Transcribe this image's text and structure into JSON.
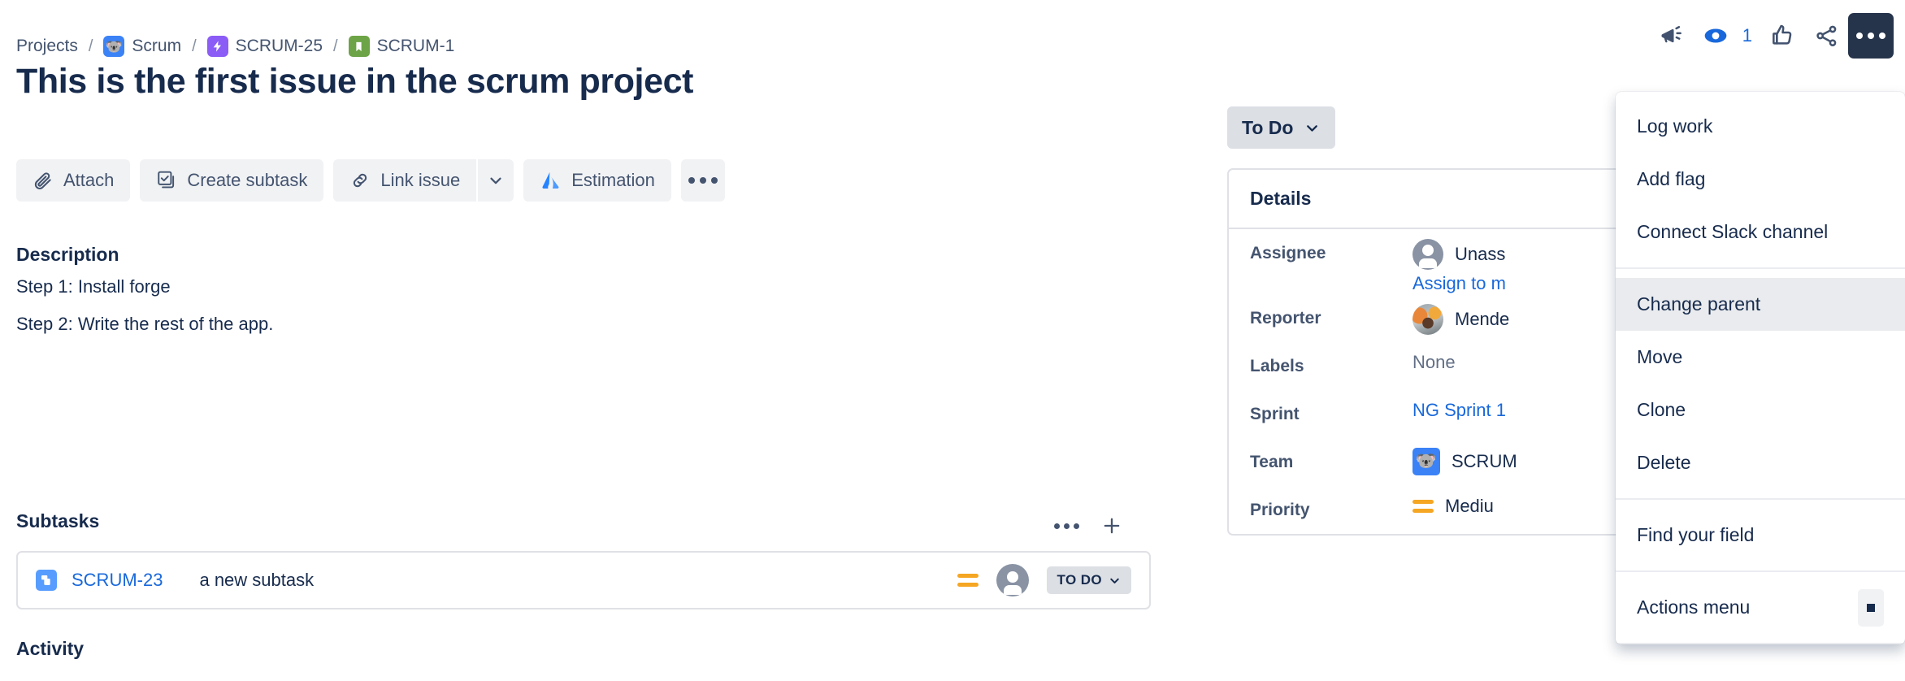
{
  "breadcrumb": {
    "items": [
      {
        "label": "Projects",
        "icon": null
      },
      {
        "label": "Scrum",
        "icon": "koala-project-icon"
      },
      {
        "label": "SCRUM-25",
        "icon": "epic-icon"
      },
      {
        "label": "SCRUM-1",
        "icon": "story-icon"
      }
    ],
    "separator": "/"
  },
  "header_actions": {
    "feedback_icon": "megaphone-icon",
    "watch_icon": "eye-icon",
    "watch_count": "1",
    "vote_icon": "thumbs-up-icon",
    "share_icon": "share-icon",
    "more_icon": "more-actions-icon"
  },
  "issue": {
    "title": "This is the first issue in the scrum project"
  },
  "toolbar": {
    "attach_label": "Attach",
    "create_subtask_label": "Create subtask",
    "link_issue_label": "Link issue",
    "estimation_label": "Estimation",
    "more_label": "More actions"
  },
  "description": {
    "heading": "Description",
    "line1": "Step 1: Install forge",
    "line2": "Step 2: Write the rest of the app."
  },
  "subtasks": {
    "heading": "Subtasks",
    "items": [
      {
        "key": "SCRUM-23",
        "summary": "a new subtask",
        "priority": "Medium",
        "assignee": "Unassigned",
        "status": "TO DO"
      }
    ]
  },
  "activity": {
    "heading": "Activity"
  },
  "status": {
    "current": "To Do"
  },
  "details": {
    "heading": "Details",
    "fields": [
      {
        "label": "Assignee",
        "value": "Unass",
        "extra": "Assign to m",
        "type": "user-avatar"
      },
      {
        "label": "Reporter",
        "value": "Mende",
        "type": "user-photo"
      },
      {
        "label": "Labels",
        "value": "None",
        "type": "muted"
      },
      {
        "label": "Sprint",
        "value": "NG Sprint 1",
        "type": "link"
      },
      {
        "label": "Team",
        "value": "SCRUM",
        "type": "team"
      },
      {
        "label": "Priority",
        "value": "Mediu",
        "type": "priority"
      }
    ]
  },
  "menu": {
    "groups": [
      {
        "items": [
          {
            "label": "Log work",
            "highlighted": false,
            "shortcut": null
          },
          {
            "label": "Add flag",
            "highlighted": false,
            "shortcut": null
          },
          {
            "label": "Connect Slack channel",
            "highlighted": false,
            "shortcut": null
          }
        ]
      },
      {
        "items": [
          {
            "label": "Change parent",
            "highlighted": true,
            "shortcut": null
          },
          {
            "label": "Move",
            "highlighted": false,
            "shortcut": null
          },
          {
            "label": "Clone",
            "highlighted": false,
            "shortcut": null
          },
          {
            "label": "Delete",
            "highlighted": false,
            "shortcut": null
          }
        ]
      },
      {
        "items": [
          {
            "label": "Find your field",
            "highlighted": false,
            "shortcut": null
          }
        ]
      },
      {
        "items": [
          {
            "label": "Actions menu",
            "highlighted": false,
            "shortcut": "."
          }
        ]
      }
    ]
  },
  "colors": {
    "brand_blue": "#1868DB",
    "text_primary": "#172B4D",
    "text_subtle": "#44546F",
    "neutral_bg": "#F1F2F4",
    "border": "#DFE1E6",
    "epic_purple": "#8B5CF6",
    "story_green": "#6DA447",
    "priority_orange": "#F5A623",
    "dark_active": "#26344B"
  }
}
